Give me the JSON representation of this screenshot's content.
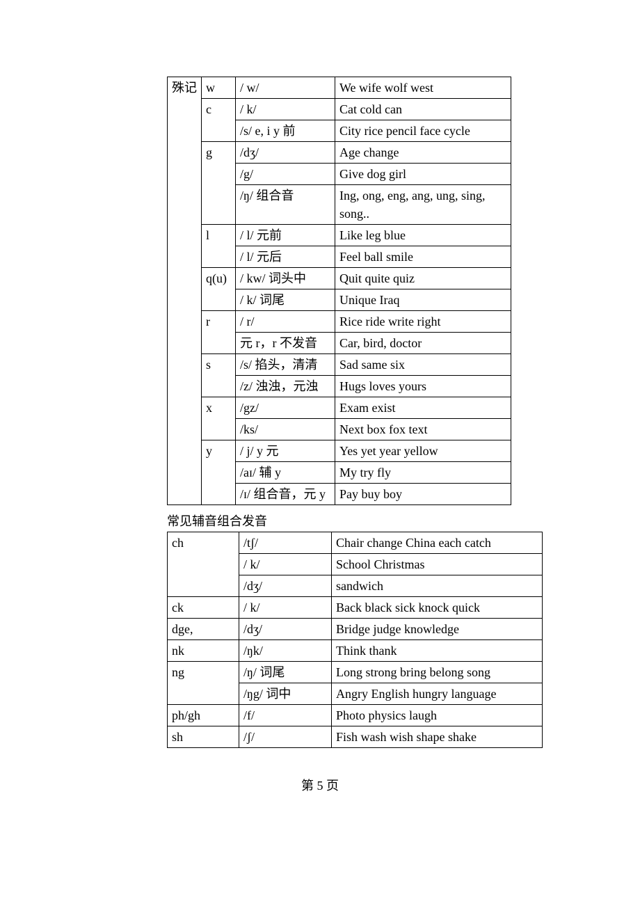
{
  "table1": {
    "header_col0": "殊记",
    "rows": [
      {
        "letter": "w",
        "phon": "/ w/",
        "ex": "We  wife  wolf  west"
      },
      {
        "letter": "c",
        "phon": "/ k/",
        "ex": "Cat  cold  can"
      },
      {
        "letter": "",
        "phon": "/s/   e, i  y  前",
        "ex": "City rice  pencil  face  cycle"
      },
      {
        "letter": "g",
        "phon": "/dʒ/",
        "ex": "Age  change"
      },
      {
        "letter": "",
        "phon": " /g/",
        "ex": "Give  dog  girl"
      },
      {
        "letter": "",
        "phon": "/ŋ/  组合音",
        "ex": " Ing, ong, eng, ang, ung, sing,  song.."
      },
      {
        "letter": "l",
        "phon": "/ l/    元前",
        "ex": "Like  leg  blue"
      },
      {
        "letter": "",
        "phon": "/ l/     元后",
        "ex": " Feel  ball  smile"
      },
      {
        "letter": "q(u)",
        "phon": "/ kw/  词头中",
        "ex": " Quit  quite  quiz"
      },
      {
        "letter": "",
        "phon": "/ k/     词尾",
        "ex": " Unique  Iraq"
      },
      {
        "letter": "r",
        "phon": "/ r/",
        "ex": "Rice  ride  write  right"
      },
      {
        "letter": "",
        "phon": "元 r，r 不发音",
        "ex": "Car,  bird,  doctor"
      },
      {
        "letter": "s",
        "phon": "/s/  掐头，清清",
        "ex": "Sad  same  six"
      },
      {
        "letter": "",
        "phon": "/z/   浊浊，元浊",
        "ex": "Hugs  loves  yours"
      },
      {
        "letter": "x",
        "phon": "/gz/",
        "ex": "Exam  exist"
      },
      {
        "letter": "",
        "phon": "/ks/",
        "ex": "Next  box  fox   text"
      },
      {
        "letter": "y",
        "phon": "/ j/   y 元",
        "ex": "Yes  yet  year  yellow"
      },
      {
        "letter": "",
        "phon": "/aɪ/  辅 y",
        "ex": "My    try  fly"
      },
      {
        "letter": "",
        "phon": "/ɪ/  组合音，元 y",
        "ex": "Pay    buy  boy"
      }
    ]
  },
  "section_title": "常见辅音组合发音",
  "table2": {
    "rows": [
      {
        "comb": "ch",
        "phon": "/tʃ/",
        "ex": "Chair change China each catch"
      },
      {
        "comb": "",
        "phon": "/ k/",
        "ex": "School Christmas"
      },
      {
        "comb": "",
        "phon": "/dʒ/",
        "ex": "sandwich"
      },
      {
        "comb": "ck",
        "phon": "/ k/",
        "ex": "Back  black sick  knock  quick"
      },
      {
        "comb": "dge,",
        "phon": "/dʒ/",
        "ex": "Bridge  judge  knowledge"
      },
      {
        "comb": "nk",
        "phon": "/ŋk/",
        "ex": "Think thank"
      },
      {
        "comb": "ng",
        "phon": "/ŋ/ 词尾",
        "ex": "Long  strong  bring belong song"
      },
      {
        "comb": "",
        "phon": "/ŋg/ 词中",
        "ex": "Angry English hungry language"
      },
      {
        "comb": "ph/gh",
        "phon": "/f/",
        "ex": "Photo physics laugh"
      },
      {
        "comb": "sh",
        "phon": "/ʃ/",
        "ex": "Fish wash wish shape shake"
      }
    ]
  },
  "footer": "第 5 页"
}
